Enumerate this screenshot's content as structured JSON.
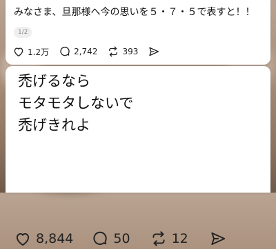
{
  "top_post": {
    "text": "みなさま、旦那様へ今の思いを５・７・５で表すと！！",
    "page_indicator": "1/2",
    "actions": {
      "like_count": "1.2万",
      "reply_count": "2,742",
      "repost_count": "393"
    }
  },
  "main_post": {
    "lines": [
      "禿げるなら",
      "モタモタしないで",
      "禿げきれよ"
    ],
    "actions": {
      "like_count": "8,844",
      "reply_count": "50",
      "repost_count": "12"
    }
  },
  "icons": {
    "like": "heart-icon",
    "reply": "speech-bubble-icon",
    "repost": "repost-arrows-icon",
    "share": "send-icon"
  }
}
